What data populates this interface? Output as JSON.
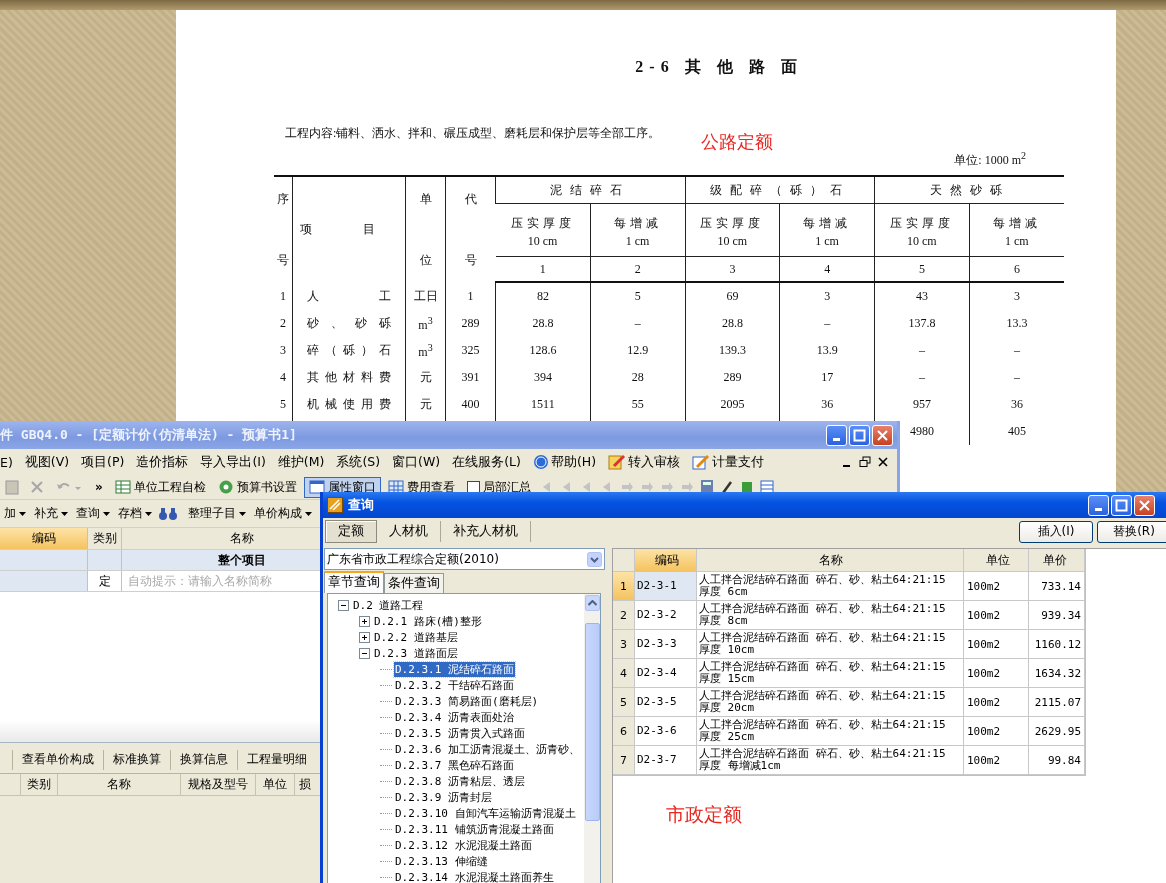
{
  "document": {
    "title": "2-6 其 他 路 面",
    "content": "工程内容:铺料、洒水、拌和、碾压成型、磨耗层和保护层等全部工序。",
    "unit": "单位: 1000 m$^{2}$",
    "table": {
      "no_top": "序",
      "no_bottom": "号",
      "item": "项 目",
      "unit_top": "单",
      "unit_bottom": "位",
      "code_top": "代",
      "code_bottom": "号",
      "groups": [
        {
          "label": "泥结碎石",
          "columns": [
            {
              "label": "压实厚度",
              "sub": "10 cm",
              "number": "1"
            },
            {
              "label": "每增减",
              "sub": "1 cm",
              "number": "2"
            }
          ]
        },
        {
          "label": "级配碎（砾）石",
          "columns": [
            {
              "label": "压实厚度",
              "sub": "10 cm",
              "number": "3"
            },
            {
              "label": "每增减",
              "sub": "1 cm",
              "number": "4"
            }
          ]
        },
        {
          "label": "天然砂砾",
          "columns": [
            {
              "label": "压实厚度",
              "sub": "10 cm",
              "number": "5"
            },
            {
              "label": "每增减",
              "sub": "1 cm",
              "number": "6"
            }
          ]
        }
      ],
      "rows": [
        {
          "no": "1",
          "item": "人工",
          "unit": "工日",
          "code": "1",
          "values": [
            "82",
            "5",
            "69",
            "3",
            "43",
            "3"
          ]
        },
        {
          "no": "2",
          "item": "砂、砂砾",
          "unit": "m$^{3}$",
          "code": "289",
          "values": [
            "28.8",
            "–",
            "28.8",
            "–",
            "137.8",
            "13.3"
          ]
        },
        {
          "no": "3",
          "item": "碎（砾）石",
          "unit": "m$^{3}$",
          "code": "325",
          "values": [
            "128.6",
            "12.9",
            "139.3",
            "13.9",
            "–",
            "–"
          ]
        },
        {
          "no": "4",
          "item": "其他材料费",
          "unit": "元",
          "code": "391",
          "values": [
            "394",
            "28",
            "289",
            "17",
            "–",
            "–"
          ]
        },
        {
          "no": "5",
          "item": "机械使用费",
          "unit": "元",
          "code": "400",
          "values": [
            "1511",
            "55",
            "2095",
            "36",
            "957",
            "36"
          ]
        }
      ],
      "partial_row": [
        "4980",
        "405"
      ]
    }
  },
  "notes": [
    "公路定额",
    "市政定额"
  ],
  "main_window": {
    "title": "件 GBQ4.0 - [定额计价(仿清单法) - 预算书1]",
    "menu": [
      {
        "label": "E)",
        "kind": "plain"
      },
      {
        "label": "视图(V)",
        "kind": "plain"
      },
      {
        "label": "项目(P)",
        "kind": "plain"
      },
      {
        "label": "造价指标",
        "kind": "plain"
      },
      {
        "label": "导入导出(I)",
        "kind": "plain"
      },
      {
        "label": "维护(M)",
        "kind": "plain"
      },
      {
        "label": "系统(S)",
        "kind": "plain"
      },
      {
        "label": "窗口(W)",
        "kind": "plain"
      },
      {
        "label": "在线服务(L)",
        "kind": "plain"
      },
      {
        "label": "帮助(H)",
        "kind": "help"
      },
      {
        "label": "转入审核",
        "kind": "review"
      },
      {
        "label": "计量支付",
        "kind": "payment"
      }
    ],
    "toolbar": [
      {
        "kind": "paste",
        "pressed": false
      },
      {
        "kind": "delete",
        "pressed": false
      },
      {
        "kind": "undo",
        "pressed": false
      },
      {
        "kind": "more",
        "label": "»",
        "pressed": false
      },
      {
        "kind": "check",
        "label": "单位工程自检",
        "pressed": false
      },
      {
        "kind": "settings",
        "label": "预算书设置",
        "pressed": false
      },
      {
        "kind": "window",
        "label": "属性窗口",
        "pressed": true
      },
      {
        "kind": "fees",
        "label": "费用查看",
        "pressed": false
      },
      {
        "kind": "checkbox",
        "label": "局部汇总",
        "checked": false,
        "pressed": false
      }
    ],
    "toolbar2": [
      {
        "kind": "menu",
        "label": "加"
      },
      {
        "kind": "menu",
        "label": "补充"
      },
      {
        "kind": "menu",
        "label": "查询"
      },
      {
        "kind": "menu",
        "label": "存档"
      },
      {
        "kind": "search"
      },
      {
        "kind": "menu",
        "label": "整理子目"
      },
      {
        "kind": "menu",
        "label": "单价构成"
      }
    ],
    "grid": {
      "columns": [
        {
          "label": "编码",
          "selected": true
        },
        {
          "label": "类别",
          "selected": false
        },
        {
          "label": "名称",
          "selected": false
        }
      ],
      "rows": [
        {
          "kind": "group",
          "name": "整个项目"
        },
        {
          "kind": "item",
          "type": "定",
          "placeholder": "自动提示：请输入名称简称"
        }
      ]
    },
    "lower_tabs": [
      "查看单价构成",
      "标准换算",
      "换算信息",
      "工程量明细"
    ],
    "lower_columns": [
      "类别",
      "名称",
      "规格及型号",
      "单位",
      "损"
    ]
  },
  "query_window": {
    "title": "查询",
    "tabs": [
      {
        "label": "定额",
        "selected": true
      },
      {
        "label": "人材机",
        "selected": false
      },
      {
        "label": "补充人材机",
        "selected": false
      }
    ],
    "buttons": [
      "插入(I)",
      "替换(R)"
    ],
    "library": "广东省市政工程综合定额(2010)",
    "subtabs": [
      {
        "label": "章节查询",
        "selected": true
      },
      {
        "label": "条件查询",
        "selected": false
      }
    ],
    "tree": [
      {
        "label": "D.2 道路工程",
        "expanded": true,
        "selected": false,
        "children": [
          {
            "label": "D.2.1 路床(槽)整形",
            "expanded": false,
            "selected": false
          },
          {
            "label": "D.2.2 道路基层",
            "expanded": false,
            "selected": false
          },
          {
            "label": "D.2.3 道路面层",
            "expanded": true,
            "selected": false,
            "children": [
              {
                "label": "D.2.3.1 泥结碎石路面",
                "selected": true
              },
              {
                "label": "D.2.3.2 干结碎石路面",
                "selected": false
              },
              {
                "label": "D.2.3.3 简易路面(磨耗层)",
                "selected": false
              },
              {
                "label": "D.2.3.4 沥青表面处治",
                "selected": false
              },
              {
                "label": "D.2.3.5 沥青贯入式路面",
                "selected": false
              },
              {
                "label": "D.2.3.6 加工沥青混凝土、沥青砂、",
                "selected": false
              },
              {
                "label": "D.2.3.7 黑色碎石路面",
                "selected": false
              },
              {
                "label": "D.2.3.8 沥青粘层、透层",
                "selected": false
              },
              {
                "label": "D.2.3.9 沥青封层",
                "selected": false
              },
              {
                "label": "D.2.3.10 自卸汽车运输沥青混凝土",
                "selected": false
              },
              {
                "label": "D.2.3.11 铺筑沥青混凝土路面",
                "selected": false
              },
              {
                "label": "D.2.3.12 水泥混凝土路面",
                "selected": false
              },
              {
                "label": "D.2.3.13 伸缩缝",
                "selected": false
              },
              {
                "label": "D.2.3.14 水泥混凝土路面养生",
                "selected": false
              }
            ]
          }
        ]
      }
    ],
    "grid": {
      "columns": [
        {
          "label": "编码",
          "selected": true
        },
        {
          "label": "名称",
          "selected": false
        },
        {
          "label": "单位",
          "selected": false
        },
        {
          "label": "单价",
          "selected": false
        }
      ],
      "rows": [
        {
          "no": "1",
          "code": "D2-3-1",
          "name": "人工拌合泥结碎石路面 碎石、砂、粘土64:21:15 厚度 6cm",
          "unit": "100m2",
          "price": "733.14",
          "selected": true
        },
        {
          "no": "2",
          "code": "D2-3-2",
          "name": "人工拌合泥结碎石路面 碎石、砂、粘土64:21:15 厚度 8cm",
          "unit": "100m2",
          "price": "939.34",
          "selected": false
        },
        {
          "no": "3",
          "code": "D2-3-3",
          "name": "人工拌合泥结碎石路面 碎石、砂、粘土64:21:15 厚度 10cm",
          "unit": "100m2",
          "price": "1160.12",
          "selected": false
        },
        {
          "no": "4",
          "code": "D2-3-4",
          "name": "人工拌合泥结碎石路面 碎石、砂、粘土64:21:15 厚度 15cm",
          "unit": "100m2",
          "price": "1634.32",
          "selected": false
        },
        {
          "no": "5",
          "code": "D2-3-5",
          "name": "人工拌合泥结碎石路面 碎石、砂、粘土64:21:15 厚度 20cm",
          "unit": "100m2",
          "price": "2115.07",
          "selected": false
        },
        {
          "no": "6",
          "code": "D2-3-6",
          "name": "人工拌合泥结碎石路面 碎石、砂、粘土64:21:15 厚度 25cm",
          "unit": "100m2",
          "price": "2629.95",
          "selected": false
        },
        {
          "no": "7",
          "code": "D2-3-7",
          "name": "人工拌合泥结碎石路面 碎石、砂、粘土64:21:15 厚度 每增减1cm",
          "unit": "100m2",
          "price": "99.84",
          "selected": false
        }
      ]
    }
  }
}
